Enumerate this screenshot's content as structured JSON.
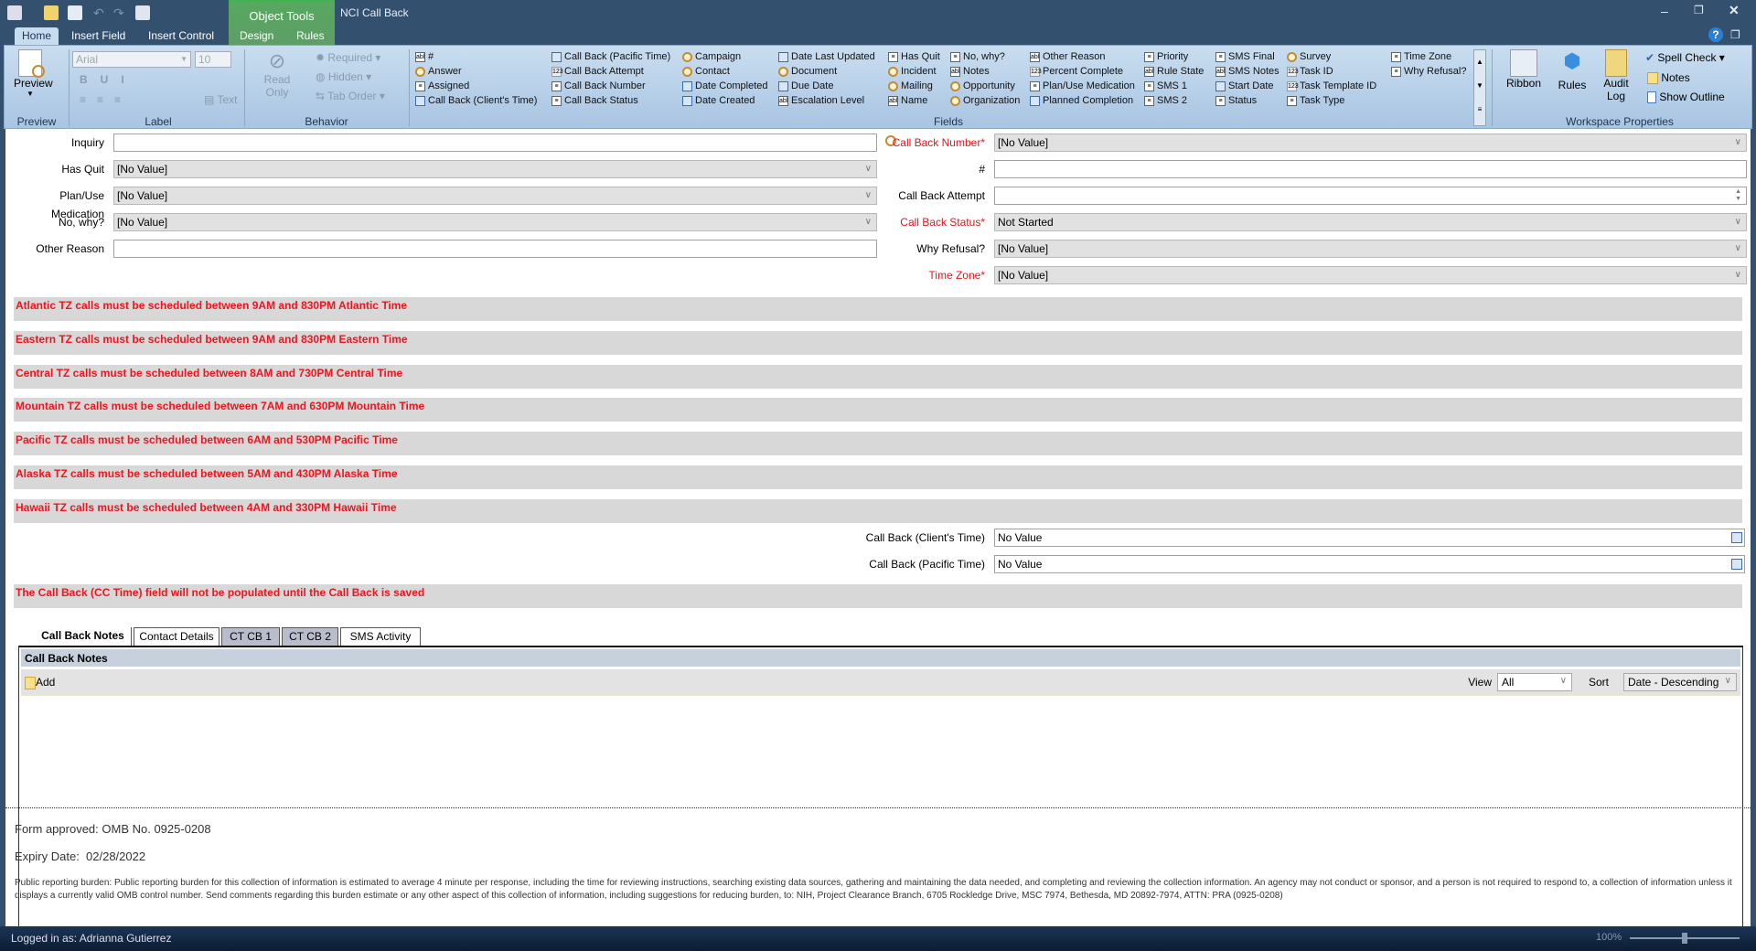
{
  "window": {
    "title": "NCI Call Back",
    "context_tab_group": "Object Tools"
  },
  "ribbon_tabs": [
    "Home",
    "Insert Field",
    "Insert Control",
    "Design",
    "Rules"
  ],
  "ribbon": {
    "preview": {
      "button": "Preview",
      "group": "Preview"
    },
    "label_group": {
      "font": "Arial",
      "size": "10",
      "text_button": "Text",
      "group": "Label"
    },
    "behavior": {
      "read_only": "Read Only",
      "required": "Required",
      "hidden": "Hidden",
      "tab_order": "Tab Order",
      "group": "Behavior"
    },
    "fields_group": "Fields",
    "fields": [
      [
        {
          "t": "text",
          "l": "#"
        },
        {
          "t": "lookup",
          "l": "Answer"
        },
        {
          "t": "list",
          "l": "Assigned"
        },
        {
          "t": "date",
          "l": "Call Back (Client's Time)"
        }
      ],
      [
        {
          "t": "date",
          "l": "Call Back (Pacific Time)"
        },
        {
          "t": "num",
          "l": "Call Back Attempt"
        },
        {
          "t": "list",
          "l": "Call Back Number"
        },
        {
          "t": "list",
          "l": "Call Back Status"
        }
      ],
      [
        {
          "t": "lookup",
          "l": "Campaign"
        },
        {
          "t": "lookup",
          "l": "Contact"
        },
        {
          "t": "date",
          "l": "Date Completed"
        },
        {
          "t": "date",
          "l": "Date Created"
        }
      ],
      [
        {
          "t": "date",
          "l": "Date Last Updated"
        },
        {
          "t": "lookup",
          "l": "Document"
        },
        {
          "t": "date",
          "l": "Due Date"
        },
        {
          "t": "text",
          "l": "Escalation Level"
        }
      ],
      [
        {
          "t": "list",
          "l": "Has Quit"
        },
        {
          "t": "lookup",
          "l": "Incident"
        },
        {
          "t": "lookup",
          "l": "Mailing"
        },
        {
          "t": "text",
          "l": "Name"
        }
      ],
      [
        {
          "t": "list",
          "l": "No, why?"
        },
        {
          "t": "text",
          "l": "Notes"
        },
        {
          "t": "lookup",
          "l": "Opportunity"
        },
        {
          "t": "lookup",
          "l": "Organization"
        }
      ],
      [
        {
          "t": "text",
          "l": "Other Reason"
        },
        {
          "t": "num",
          "l": "Percent Complete"
        },
        {
          "t": "list",
          "l": "Plan/Use Medication"
        },
        {
          "t": "date",
          "l": "Planned Completion"
        }
      ],
      [
        {
          "t": "list",
          "l": "Priority"
        },
        {
          "t": "text",
          "l": "Rule State"
        },
        {
          "t": "list",
          "l": "SMS 1"
        },
        {
          "t": "list",
          "l": "SMS 2"
        }
      ],
      [
        {
          "t": "list",
          "l": "SMS Final"
        },
        {
          "t": "text",
          "l": "SMS Notes"
        },
        {
          "t": "date",
          "l": "Start Date"
        },
        {
          "t": "list",
          "l": "Status"
        }
      ],
      [
        {
          "t": "lookup",
          "l": "Survey"
        },
        {
          "t": "num",
          "l": "Task ID"
        },
        {
          "t": "num",
          "l": "Task Template ID"
        },
        {
          "t": "list",
          "l": "Task Type"
        }
      ],
      [
        {
          "t": "list",
          "l": "Time Zone"
        },
        {
          "t": "list",
          "l": "Why Refusal?"
        }
      ]
    ],
    "workspace": {
      "ribbon": "Ribbon",
      "rules": "Rules",
      "audit_log": "Audit Log",
      "spell_check": "Spell Check",
      "notes": "Notes",
      "show_outline": "Show Outline",
      "group": "Workspace Properties"
    }
  },
  "form": {
    "left": [
      {
        "label": "Inquiry",
        "value": "",
        "kind": "lookup"
      },
      {
        "label": "Has Quit",
        "value": "[No Value]",
        "kind": "select"
      },
      {
        "label": "Plan/Use Medication",
        "value": "[No Value]",
        "kind": "select"
      },
      {
        "label": "No, why?",
        "value": "[No Value]",
        "kind": "select"
      },
      {
        "label": "Other Reason",
        "value": "",
        "kind": "text"
      }
    ],
    "right": [
      {
        "label": "Call Back Number*",
        "value": "[No Value]",
        "kind": "select",
        "required": true
      },
      {
        "label": "#",
        "value": "",
        "kind": "text"
      },
      {
        "label": "Call Back Attempt",
        "value": "",
        "kind": "spin"
      },
      {
        "label": "Call Back Status*",
        "value": "Not Started",
        "kind": "select",
        "required": true
      },
      {
        "label": "Why Refusal?",
        "value": "[No Value]",
        "kind": "select"
      },
      {
        "label": "Time Zone*",
        "value": "[No Value]",
        "kind": "select",
        "required": true
      }
    ],
    "banners": [
      "Atlantic TZ calls must be scheduled between 9AM and 830PM Atlantic Time",
      "Eastern TZ calls must be scheduled between 9AM and 830PM Eastern Time",
      "Central TZ calls must be scheduled between 8AM and 730PM Central Time",
      "Mountain TZ calls must be scheduled between 7AM and 630PM Mountain Time",
      "Pacific TZ calls must be scheduled between 6AM and 530PM Pacific Time",
      "Alaska TZ calls must be scheduled between 5AM and 430PM Alaska Time",
      "Hawaii TZ calls must be scheduled between 4AM and 330PM Hawaii Time"
    ],
    "callback_times": [
      {
        "label": "Call Back (Client's Time)",
        "value": "No Value"
      },
      {
        "label": "Call Back (Pacific Time)",
        "value": "No Value"
      }
    ],
    "cc_banner": "The Call Back (CC Time) field will not be populated until the Call Back is saved",
    "tabs": [
      "Call Back Notes",
      "Contact Details",
      "CT CB 1",
      "CT CB 2",
      "SMS Activity"
    ],
    "notes_panel": {
      "title": "Call Back Notes",
      "add": "Add",
      "view_label": "View",
      "view_value": "All",
      "sort_label": "Sort",
      "sort_value": "Date - Descending"
    },
    "footer": {
      "omb": "Form approved: OMB No. 0925-0208",
      "expiry": "Expiry Date:  02/28/2022",
      "burden": "Public reporting burden: Public reporting burden for this collection of information is estimated to average 4 minute per response, including the time for reviewing instructions, searching existing data sources, gathering and maintaining the data needed, and completing and reviewing the collection information.  An agency may not conduct or sponsor, and a person is not required to respond to, a collection of information unless it displays a currently valid OMB control number.  Send comments regarding this burden estimate or any other aspect of this collection of information, including suggestions for reducing burden, to: NIH, Project Clearance Branch, 6705 Rockledge Drive, MSC 7974, Bethesda, MD 20892-7974, ATTN: PRA (0925-0208)"
    }
  },
  "status": {
    "logged_in": "Logged in as: Adrianna Gutierrez",
    "zoom": "100%",
    "zoom_level": 100
  }
}
